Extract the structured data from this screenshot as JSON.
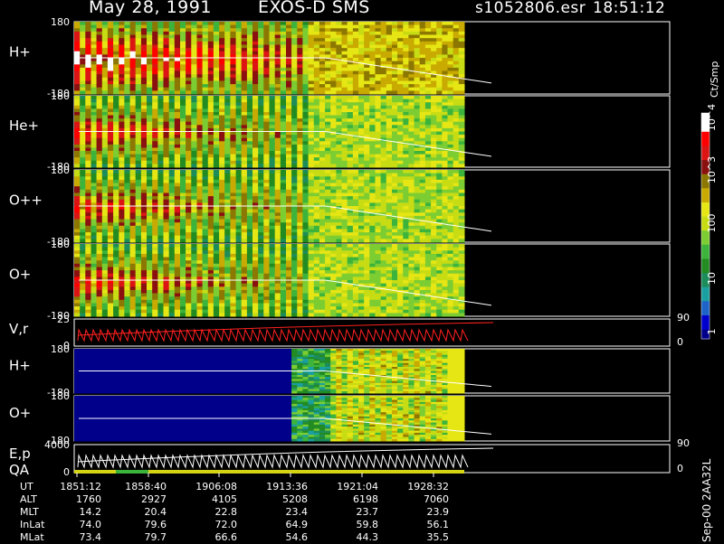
{
  "header": {
    "date": "May 28, 1991",
    "instrument": "EXOS-D SMS",
    "file": "s1052806.esr",
    "time": "18:51:12"
  },
  "colorbar": {
    "unit": "Ct/Smp",
    "ticks": [
      "1",
      "10",
      "100",
      "10^3",
      "10^4"
    ]
  },
  "side_note": "Sep-00 2AA32L",
  "chart_data": {
    "type": "heatmap",
    "panels": [
      {
        "name": "H+",
        "ymin": "-180",
        "ymax": "180"
      },
      {
        "name": "He+",
        "ymin": "-180",
        "ymax": "180"
      },
      {
        "name": "O++",
        "ymin": "-180",
        "ymax": "180"
      },
      {
        "name": "O+",
        "ymin": "-180",
        "ymax": "180"
      },
      {
        "name": "V,r",
        "ymin": "0",
        "ymax": "25",
        "rmin": "0",
        "rmax": "90"
      },
      {
        "name": "H+",
        "ymin": "-180",
        "ymax": "180"
      },
      {
        "name": "O+",
        "ymin": "-180",
        "ymax": "180"
      },
      {
        "name": "E,p",
        "sub": "QA",
        "ymin": "0",
        "ymax": "4000",
        "rmin": "0",
        "rmax": "90"
      }
    ],
    "x_ticks": [
      "1851:12",
      "1858:40",
      "1906:08",
      "1913:36",
      "1921:04",
      "1928:32"
    ],
    "ephemeris": [
      {
        "label": "UT",
        "values": [
          "1851:12",
          "1858:40",
          "1906:08",
          "1913:36",
          "1921:04",
          "1928:32"
        ]
      },
      {
        "label": "ALT",
        "values": [
          "1760",
          "2927",
          "4105",
          "5208",
          "6198",
          "7060"
        ]
      },
      {
        "label": "MLT",
        "values": [
          "14.2",
          "20.4",
          "22.8",
          "23.4",
          "23.7",
          "23.9"
        ]
      },
      {
        "label": "InLat",
        "values": [
          "74.0",
          "79.6",
          "72.0",
          "64.9",
          "59.8",
          "56.1"
        ]
      },
      {
        "label": "MLat",
        "values": [
          "73.4",
          "79.7",
          "66.6",
          "54.6",
          "44.3",
          "35.5"
        ]
      }
    ]
  }
}
